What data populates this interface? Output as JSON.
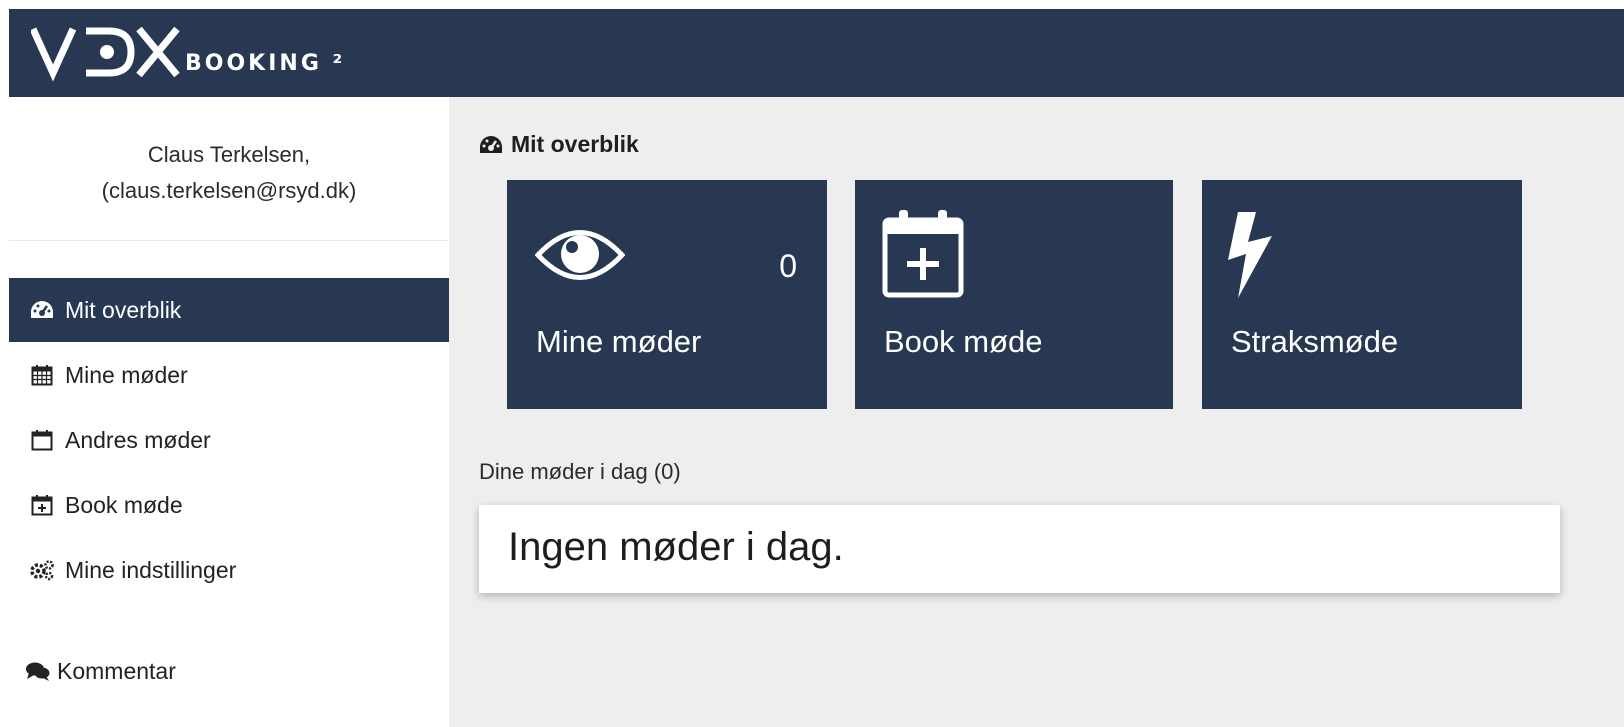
{
  "header": {
    "logo_text": "VDX",
    "logo_subtitle": "BOOKING ²"
  },
  "user": {
    "name": "Claus Terkelsen,",
    "email": "(claus.terkelsen@rsyd.dk)"
  },
  "sidebar": {
    "items": [
      {
        "label": "Mit overblik",
        "icon": "dashboard-icon",
        "active": true
      },
      {
        "label": "Mine møder",
        "icon": "calendar-grid-icon",
        "active": false
      },
      {
        "label": "Andres møder",
        "icon": "calendar-icon",
        "active": false
      },
      {
        "label": "Book møde",
        "icon": "calendar-plus-icon",
        "active": false
      },
      {
        "label": "Mine indstillinger",
        "icon": "gears-icon",
        "active": false
      }
    ],
    "comment_label": "Kommentar"
  },
  "main": {
    "section_title": "Mit overblik",
    "tiles": [
      {
        "label": "Mine møder",
        "icon": "eye-icon",
        "count": "0"
      },
      {
        "label": "Book møde",
        "icon": "calendar-plus-icon"
      },
      {
        "label": "Straksmøde",
        "icon": "bolt-icon"
      }
    ],
    "today_label": "Dine møder i dag (0)",
    "today_empty": "Ingen møder i dag."
  },
  "colors": {
    "brand_navy": "#283853",
    "main_background": "#eeeeee"
  }
}
